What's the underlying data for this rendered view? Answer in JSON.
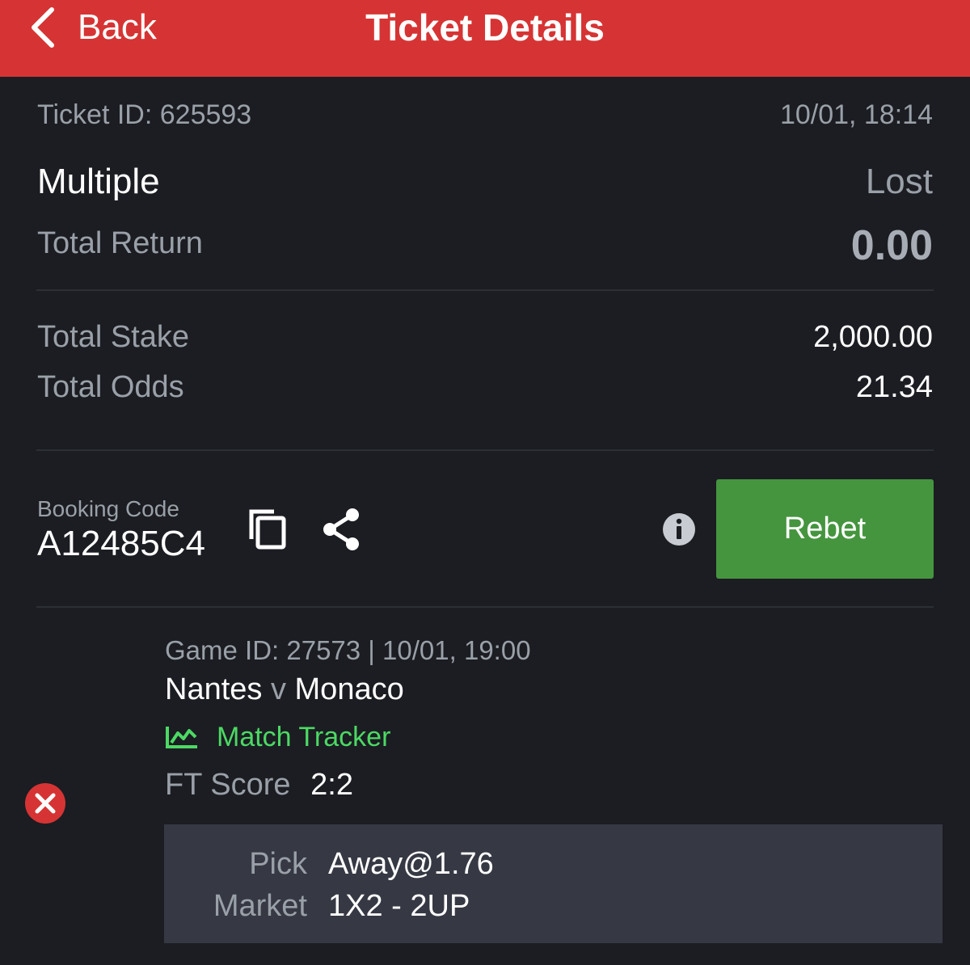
{
  "header": {
    "back_label": "Back",
    "title": "Ticket Details"
  },
  "ticket": {
    "id_text": "Ticket ID: 625593",
    "datetime": "10/01, 18:14",
    "type": "Multiple",
    "status": "Lost",
    "total_return_label": "Total Return",
    "total_return_value": "0.00",
    "total_stake_label": "Total Stake",
    "total_stake_value": "2,000.00",
    "total_odds_label": "Total Odds",
    "total_odds_value": "21.34"
  },
  "booking": {
    "label": "Booking Code",
    "code": "A12485C4",
    "copy_icon": "copy-icon",
    "share_icon": "share-icon",
    "info_icon": "info-icon",
    "rebet_label": "Rebet"
  },
  "game": {
    "meta": "Game ID: 27573 | 10/01, 19:00",
    "home": "Nantes",
    "vs": "v",
    "away": "Monaco",
    "tracker_label": "Match Tracker",
    "tracker_icon": "chart-icon",
    "score_label": "FT Score",
    "score_value": "2:2",
    "result_icon": "lost-x-icon",
    "pick_label": "Pick",
    "pick_value": "Away@1.76",
    "market_label": "Market",
    "market_value": "1X2 - 2UP"
  },
  "colors": {
    "header_red": "#d63434",
    "background": "#1b1d22",
    "rebet_green": "#45953f",
    "tracker_green": "#4cd964",
    "lost_red": "#d63434",
    "pick_box": "#363943"
  }
}
